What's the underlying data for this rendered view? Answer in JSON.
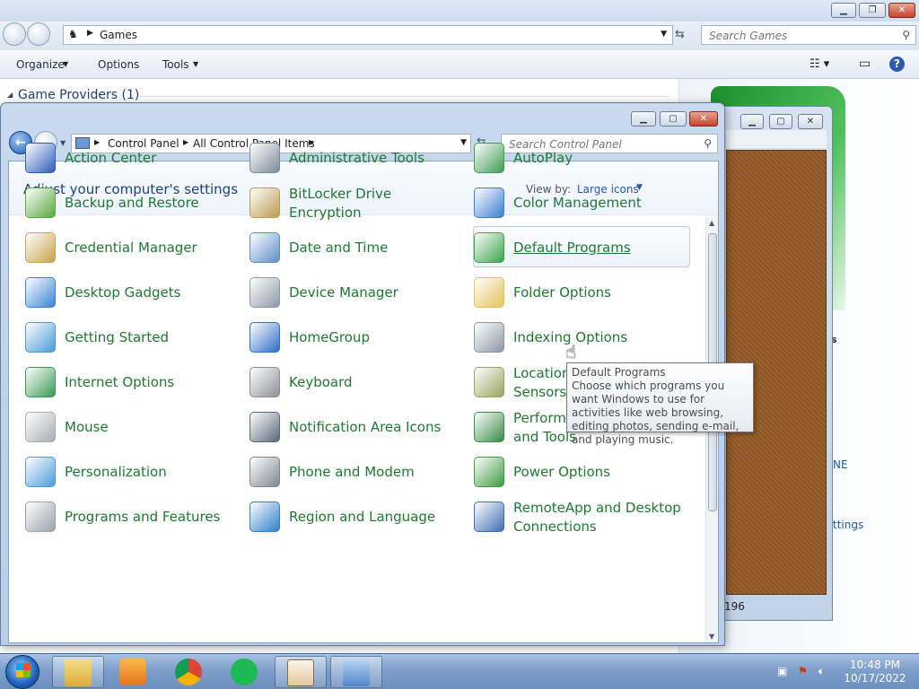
{
  "games_window": {
    "breadcrumb": "Games",
    "search_placeholder": "Search Games",
    "toolbar": {
      "organize": "Organize",
      "options": "Options",
      "tools": "Tools"
    },
    "group_title": "Game Providers (1)",
    "right_text_1": "s",
    "right_text_2": "NE",
    "right_text_3": "ttings"
  },
  "solitaire_window": {
    "status": "196"
  },
  "control_panel": {
    "breadcrumb": [
      "Control Panel",
      "All Control Panel Items"
    ],
    "search_placeholder": "Search Control Panel",
    "heading": "Adjust your computer's settings",
    "view_by_label": "View by:",
    "view_by_value": "Large icons",
    "items": [
      {
        "label": "Action Center",
        "icon": "flag-icon",
        "color": "#2e5db8"
      },
      {
        "label": "Administrative Tools",
        "icon": "admin-tools-icon",
        "color": "#7c8a98"
      },
      {
        "label": "AutoPlay",
        "icon": "autoplay-icon",
        "color": "#3f9b55"
      },
      {
        "label": "Backup and Restore",
        "icon": "backup-icon",
        "color": "#58a83c"
      },
      {
        "label": "BitLocker Drive Encryption",
        "icon": "bitlocker-icon",
        "color": "#b99a4e"
      },
      {
        "label": "Color Management",
        "icon": "color-management-icon",
        "color": "#3b7fd1"
      },
      {
        "label": "Credential Manager",
        "icon": "credential-icon",
        "color": "#c7a34a"
      },
      {
        "label": "Date and Time",
        "icon": "clock-icon",
        "color": "#5e8ec7"
      },
      {
        "label": "Default Programs",
        "icon": "default-programs-icon",
        "color": "#3aa34a"
      },
      {
        "label": "Desktop Gadgets",
        "icon": "gadgets-icon",
        "color": "#3a84d6"
      },
      {
        "label": "Device Manager",
        "icon": "device-manager-icon",
        "color": "#8c98a6"
      },
      {
        "label": "Folder Options",
        "icon": "folder-icon",
        "color": "#e4c15a"
      },
      {
        "label": "Getting Started",
        "icon": "getting-started-icon",
        "color": "#4a9ad6"
      },
      {
        "label": "HomeGroup",
        "icon": "homegroup-icon",
        "color": "#2f6fc7"
      },
      {
        "label": "Indexing Options",
        "icon": "indexing-icon",
        "color": "#8d98a3"
      },
      {
        "label": "Internet Options",
        "icon": "globe-icon",
        "color": "#3a9a56"
      },
      {
        "label": "Keyboard",
        "icon": "keyboard-icon",
        "color": "#8c8f94"
      },
      {
        "label": "Location and Other Sensors",
        "icon": "location-icon",
        "color": "#9aa45e"
      },
      {
        "label": "Mouse",
        "icon": "mouse-icon",
        "color": "#a8adb3"
      },
      {
        "label": "Notification Area Icons",
        "icon": "notification-icon",
        "color": "#5a6978"
      },
      {
        "label": "Performance Information and Tools",
        "icon": "performance-icon",
        "color": "#3b8b46"
      },
      {
        "label": "Personalization",
        "icon": "personalization-icon",
        "color": "#4b9cd8"
      },
      {
        "label": "Phone and Modem",
        "icon": "phone-icon",
        "color": "#7d8793"
      },
      {
        "label": "Power Options",
        "icon": "power-icon",
        "color": "#3c9b43"
      },
      {
        "label": "Programs and Features",
        "icon": "programs-icon",
        "color": "#9aa2ad"
      },
      {
        "label": "Region and Language",
        "icon": "region-icon",
        "color": "#2f7fc9"
      },
      {
        "label": "RemoteApp and Desktop Connections",
        "icon": "remoteapp-icon",
        "color": "#3e6fb5"
      }
    ],
    "tooltip": {
      "title": "Default Programs",
      "body": "Choose which programs you want Windows to use for activities like web browsing, editing photos, sending e-mail, and playing music."
    }
  },
  "taskbar": {
    "clock_time": "10:48 PM",
    "clock_date": "10/17/2022",
    "accent": "#7e9fcb"
  }
}
